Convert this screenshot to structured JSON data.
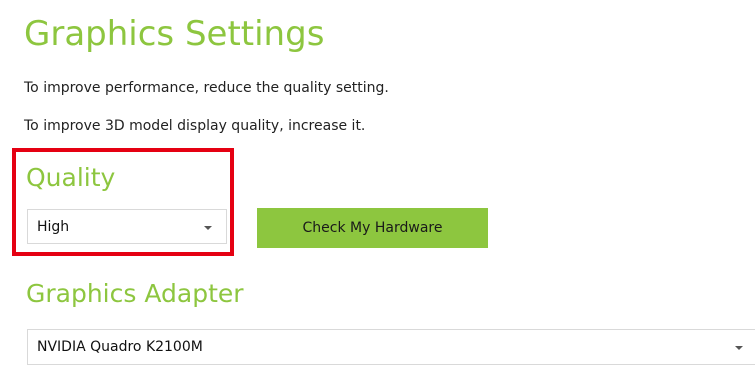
{
  "header": {
    "title": "Graphics Settings",
    "description_line1": "To improve performance, reduce the quality setting.",
    "description_line2": "To improve 3D model display quality, increase it."
  },
  "quality": {
    "title": "Quality",
    "selected": "High",
    "dropdown_icon": "chevron-down-icon",
    "check_button_label": "Check My Hardware"
  },
  "adapter": {
    "title": "Graphics Adapter",
    "selected": "NVIDIA Quadro K2100M",
    "dropdown_icon": "chevron-down-icon"
  },
  "colors": {
    "accent_green": "#8dc63f",
    "highlight_red": "#e50012",
    "text": "#222222"
  }
}
